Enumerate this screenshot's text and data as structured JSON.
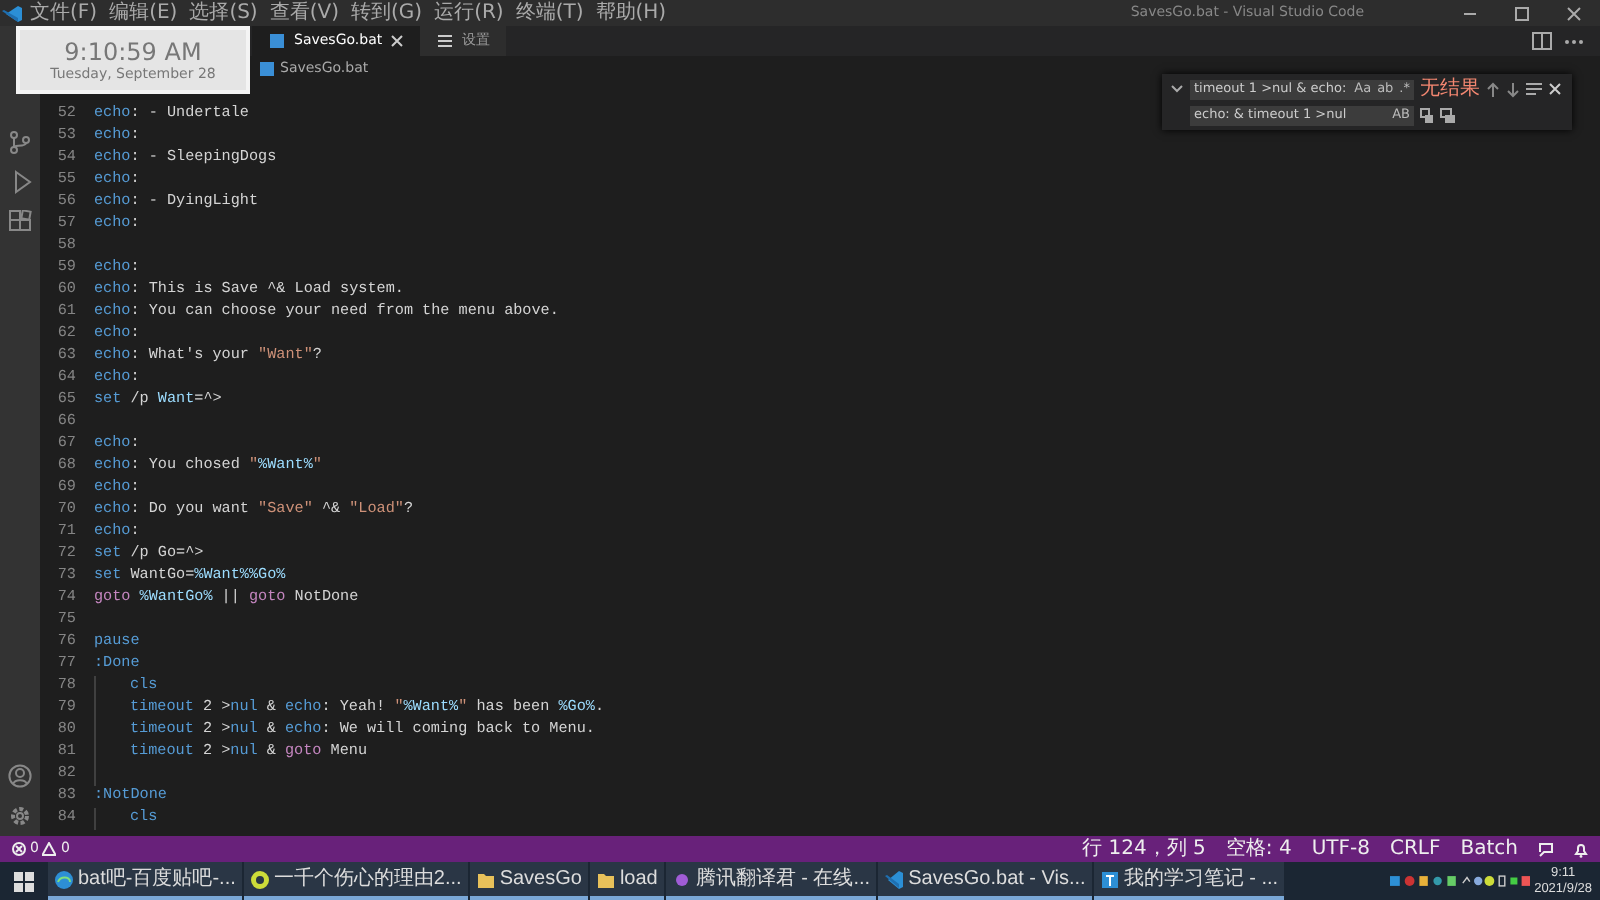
{
  "window": {
    "title": "SavesGo.bat - Visual Studio Code"
  },
  "menu": [
    "文件(F)",
    "编辑(E)",
    "选择(S)",
    "查看(V)",
    "转到(G)",
    "运行(R)",
    "终端(T)",
    "帮助(H)"
  ],
  "tabs": [
    {
      "label": "SavesGo.bat",
      "selected": true,
      "kind": "file"
    },
    {
      "label": "设置",
      "selected": false,
      "kind": "settings"
    }
  ],
  "breadcrumb": [
    "SavesGo.bat"
  ],
  "clock_widget": {
    "time": "9:10:59 AM",
    "date": "Tuesday, September 28"
  },
  "find_widget": {
    "find": "timeout 1 >nul & echo:",
    "find_options": [
      "Aa",
      "ab",
      ".*"
    ],
    "result": "无结果",
    "replace": "echo: & timeout 1 >nul",
    "replace_options": [
      "AB"
    ]
  },
  "code": [
    {
      "number": "52",
      "tokens": [
        {
          "kind": "keyword",
          "text": "echo"
        },
        {
          "kind": "plain",
          "text": ": - Undertale"
        }
      ]
    },
    {
      "number": "53",
      "tokens": [
        {
          "kind": "keyword",
          "text": "echo"
        },
        {
          "kind": "plain",
          "text": ":"
        }
      ]
    },
    {
      "number": "54",
      "tokens": [
        {
          "kind": "keyword",
          "text": "echo"
        },
        {
          "kind": "plain",
          "text": ": - SleepingDogs"
        }
      ]
    },
    {
      "number": "55",
      "tokens": [
        {
          "kind": "keyword",
          "text": "echo"
        },
        {
          "kind": "plain",
          "text": ":"
        }
      ]
    },
    {
      "number": "56",
      "tokens": [
        {
          "kind": "keyword",
          "text": "echo"
        },
        {
          "kind": "plain",
          "text": ": - DyingLight"
        }
      ]
    },
    {
      "number": "57",
      "tokens": [
        {
          "kind": "keyword",
          "text": "echo"
        },
        {
          "kind": "plain",
          "text": ":"
        }
      ]
    },
    {
      "number": "58"
    },
    {
      "number": "59",
      "tokens": [
        {
          "kind": "keyword",
          "text": "echo"
        },
        {
          "kind": "plain",
          "text": ":"
        }
      ]
    },
    {
      "number": "60",
      "tokens": [
        {
          "kind": "keyword",
          "text": "echo"
        },
        {
          "kind": "plain",
          "text": ": This is Save ^& Load system."
        }
      ]
    },
    {
      "number": "61",
      "tokens": [
        {
          "kind": "keyword",
          "text": "echo"
        },
        {
          "kind": "plain",
          "text": ": You can choose your need from the menu above."
        }
      ]
    },
    {
      "number": "62",
      "tokens": [
        {
          "kind": "keyword",
          "text": "echo"
        },
        {
          "kind": "plain",
          "text": ":"
        }
      ]
    },
    {
      "number": "63",
      "tokens": [
        {
          "kind": "keyword",
          "text": "echo"
        },
        {
          "kind": "plain",
          "text": ": What's your "
        },
        {
          "kind": "string",
          "text": "\"Want\""
        },
        {
          "kind": "plain",
          "text": "?"
        }
      ]
    },
    {
      "number": "64",
      "tokens": [
        {
          "kind": "keyword",
          "text": "echo"
        },
        {
          "kind": "plain",
          "text": ":"
        }
      ]
    },
    {
      "number": "65",
      "tokens": [
        {
          "kind": "keyword",
          "text": "set"
        },
        {
          "kind": "plain",
          "text": " /p "
        },
        {
          "kind": "variable",
          "text": "Want"
        },
        {
          "kind": "plain",
          "text": "=^>"
        }
      ]
    },
    {
      "number": "66"
    },
    {
      "number": "67",
      "tokens": [
        {
          "kind": "keyword",
          "text": "echo"
        },
        {
          "kind": "plain",
          "text": ":"
        }
      ]
    },
    {
      "number": "68",
      "tokens": [
        {
          "kind": "keyword",
          "text": "echo"
        },
        {
          "kind": "plain",
          "text": ": You chosed "
        },
        {
          "kind": "string",
          "text": "\""
        },
        {
          "kind": "variable",
          "text": "%Want%"
        },
        {
          "kind": "string",
          "text": "\""
        }
      ]
    },
    {
      "number": "69",
      "tokens": [
        {
          "kind": "keyword",
          "text": "echo"
        },
        {
          "kind": "plain",
          "text": ":"
        }
      ]
    },
    {
      "number": "70",
      "tokens": [
        {
          "kind": "keyword",
          "text": "echo"
        },
        {
          "kind": "plain",
          "text": ": Do you want "
        },
        {
          "kind": "string",
          "text": "\"Save\""
        },
        {
          "kind": "plain",
          "text": " ^& "
        },
        {
          "kind": "string",
          "text": "\"Load\""
        },
        {
          "kind": "plain",
          "text": "?"
        }
      ]
    },
    {
      "number": "71",
      "tokens": [
        {
          "kind": "keyword",
          "text": "echo"
        },
        {
          "kind": "plain",
          "text": ":"
        }
      ]
    },
    {
      "number": "72",
      "tokens": [
        {
          "kind": "keyword",
          "text": "set"
        },
        {
          "kind": "plain",
          "text": " /p Go=^>"
        }
      ]
    },
    {
      "number": "73",
      "tokens": [
        {
          "kind": "keyword",
          "text": "set"
        },
        {
          "kind": "plain",
          "text": " WantGo="
        },
        {
          "kind": "variable",
          "text": "%Want%%Go%"
        }
      ]
    },
    {
      "number": "74",
      "tokens": [
        {
          "kind": "flow",
          "text": "goto"
        },
        {
          "kind": "variable",
          "text": " %WantGo%"
        },
        {
          "kind": "plain",
          "text": " || "
        },
        {
          "kind": "flow",
          "text": "goto"
        },
        {
          "kind": "plain",
          "text": " NotDone"
        }
      ]
    },
    {
      "number": "75"
    },
    {
      "number": "76",
      "tokens": [
        {
          "kind": "keyword",
          "text": "pause"
        }
      ]
    },
    {
      "number": "77",
      "tokens": [
        {
          "kind": "keyword",
          "text": ":Done"
        }
      ],
      "children": [
        {
          "number": "78",
          "tokens": [
            {
              "kind": "keyword",
              "text": "cls"
            }
          ]
        },
        {
          "number": "79",
          "tokens": [
            {
              "kind": "keyword",
              "text": "timeout"
            },
            {
              "kind": "plain",
              "text": " 2 >"
            },
            {
              "kind": "keyword",
              "text": "nul"
            },
            {
              "kind": "plain",
              "text": " & "
            },
            {
              "kind": "keyword",
              "text": "echo"
            },
            {
              "kind": "plain",
              "text": ": Yeah! "
            },
            {
              "kind": "string",
              "text": "\""
            },
            {
              "kind": "variable",
              "text": "%Want%"
            },
            {
              "kind": "string",
              "text": "\""
            },
            {
              "kind": "plain",
              "text": " has been "
            },
            {
              "kind": "variable",
              "text": "%Go%"
            },
            {
              "kind": "plain",
              "text": "."
            }
          ]
        },
        {
          "number": "80",
          "tokens": [
            {
              "kind": "keyword",
              "text": "timeout"
            },
            {
              "kind": "plain",
              "text": " 2 >"
            },
            {
              "kind": "keyword",
              "text": "nul"
            },
            {
              "kind": "plain",
              "text": " & "
            },
            {
              "kind": "keyword",
              "text": "echo"
            },
            {
              "kind": "plain",
              "text": ": We will coming back to Menu."
            }
          ]
        },
        {
          "number": "81",
          "tokens": [
            {
              "kind": "keyword",
              "text": "timeout"
            },
            {
              "kind": "plain",
              "text": " 2 >"
            },
            {
              "kind": "keyword",
              "text": "nul"
            },
            {
              "kind": "plain",
              "text": " & "
            },
            {
              "kind": "flow",
              "text": "goto"
            },
            {
              "kind": "plain",
              "text": " Menu"
            }
          ]
        },
        {
          "number": "82"
        }
      ]
    },
    {
      "number": "83",
      "tokens": [
        {
          "kind": "keyword",
          "text": ":NotDone"
        }
      ],
      "children": [
        {
          "number": "84",
          "tokens": [
            {
              "kind": "keyword",
              "text": "cls"
            }
          ]
        }
      ]
    }
  ],
  "status_bar": {
    "errors": "0",
    "warnings": "0",
    "items": [
      "行 124，列 5",
      "空格: 4",
      "UTF-8",
      "CRLF",
      "Batch"
    ]
  },
  "taskbar": {
    "items": [
      {
        "kind": "browser",
        "label": "bat吧-百度贴吧-..."
      },
      {
        "kind": "player",
        "label": "一千个伤心的理由2..."
      },
      {
        "kind": "folder",
        "label": "SavesGo"
      },
      {
        "kind": "folder",
        "label": "load"
      },
      {
        "kind": "translator",
        "label": "腾讯翻译君 - 在线..."
      },
      {
        "kind": "editor",
        "label": "SavesGo.bat - Vis..."
      },
      {
        "kind": "notes",
        "label": "我的学习笔记 - ..."
      }
    ],
    "time": "9:11",
    "date": "2021/9/28"
  }
}
